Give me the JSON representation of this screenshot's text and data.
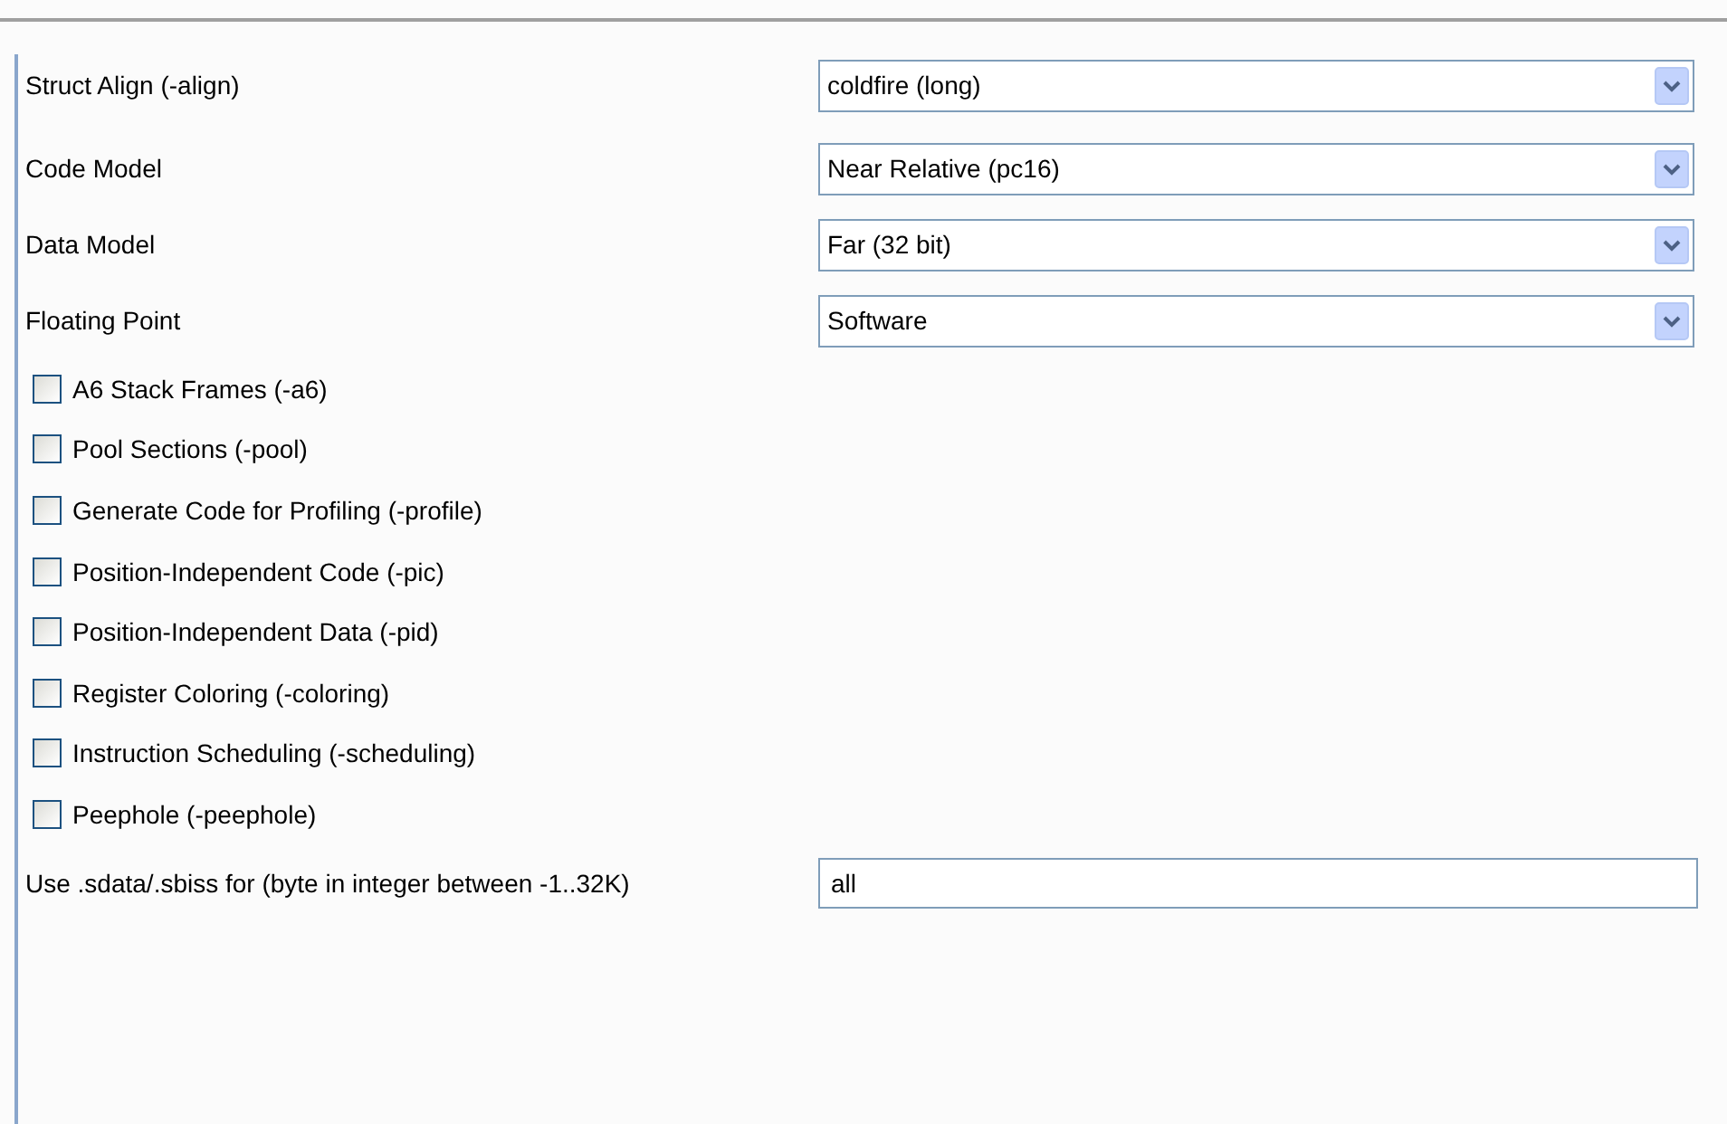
{
  "dropdowns": [
    {
      "label": "Struct Align (-align)",
      "value": "coldfire (long)"
    },
    {
      "label": "Code Model",
      "value": "Near Relative (pc16)"
    },
    {
      "label": "Data Model",
      "value": "Far (32 bit)"
    },
    {
      "label": "Floating Point",
      "value": "Software"
    }
  ],
  "checkboxes": [
    {
      "label": "A6 Stack Frames (-a6)",
      "checked": false
    },
    {
      "label": "Pool Sections (-pool)",
      "checked": false
    },
    {
      "label": "Generate Code for Profiling (-profile)",
      "checked": false
    },
    {
      "label": "Position-Independent Code (-pic)",
      "checked": false
    },
    {
      "label": "Position-Independent Data (-pid)",
      "checked": false
    },
    {
      "label": "Register Coloring (-coloring)",
      "checked": false
    },
    {
      "label": "Instruction Scheduling (-scheduling)",
      "checked": false
    },
    {
      "label": "Peephole (-peephole)",
      "checked": false
    }
  ],
  "sdata_field": {
    "label": "Use .sdata/.sbiss for (byte in integer between -1..32K)",
    "value": "all"
  }
}
